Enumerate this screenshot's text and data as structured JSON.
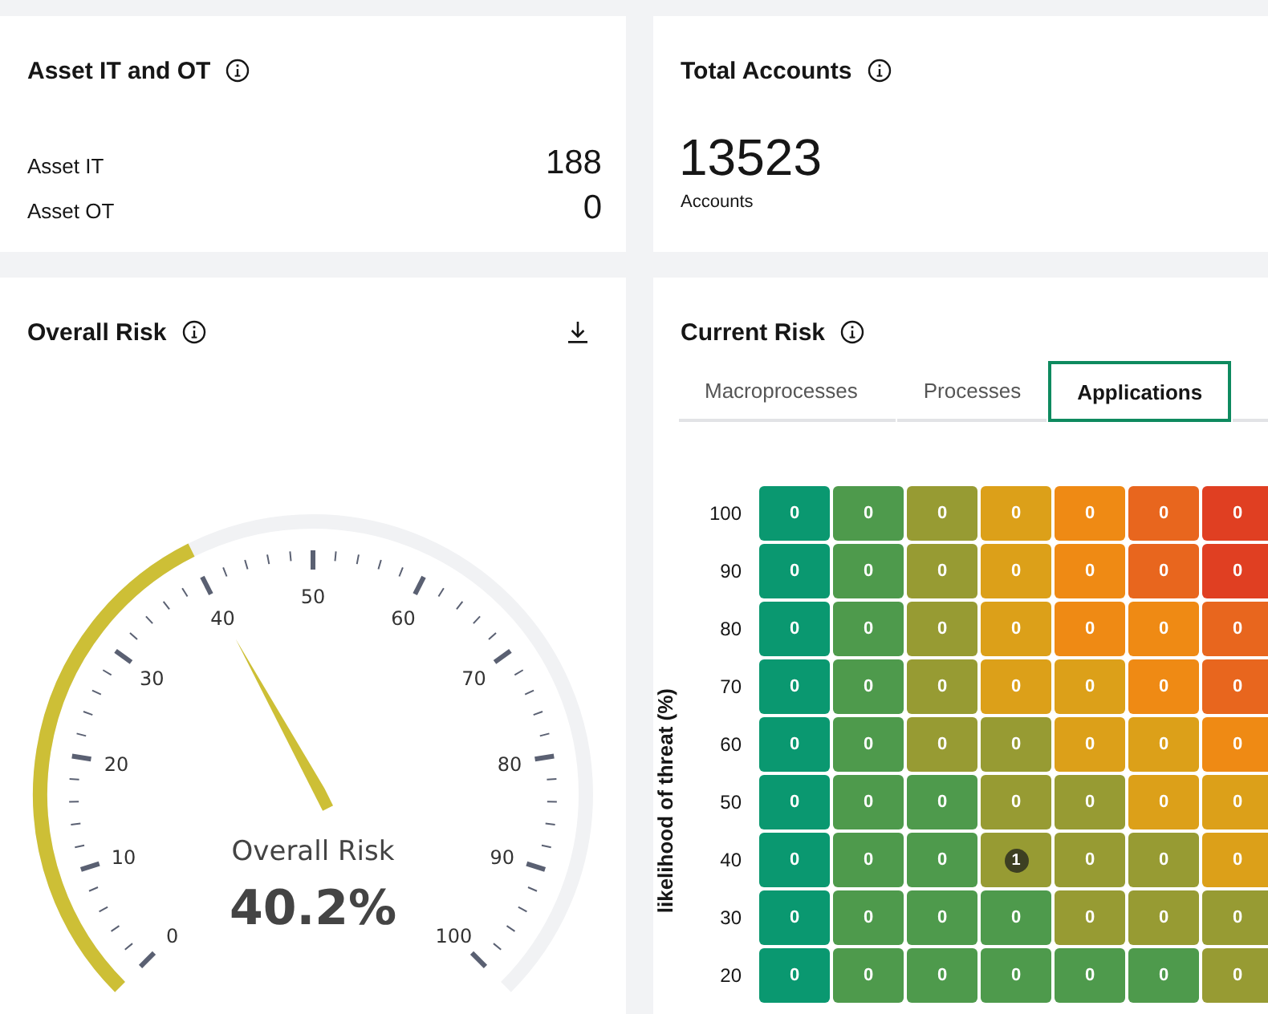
{
  "asset_card": {
    "title": "Asset IT and OT",
    "rows": [
      {
        "label": "Asset IT",
        "value": "188"
      },
      {
        "label": "Asset OT",
        "value": "0"
      }
    ]
  },
  "accounts_card": {
    "title": "Total Accounts",
    "value": "13523",
    "caption": "Accounts"
  },
  "overall_risk": {
    "title": "Overall Risk",
    "gauge": {
      "label": "Overall Risk",
      "value_text": "40.2%",
      "level": 0.402,
      "scale_labels": [
        "0",
        "10",
        "20",
        "30",
        "40",
        "50",
        "60",
        "70",
        "80",
        "90",
        "100"
      ]
    }
  },
  "current_risk": {
    "title": "Current Risk",
    "tabs": [
      {
        "label": "Macroprocesses",
        "selected": false
      },
      {
        "label": "Processes",
        "selected": false
      },
      {
        "label": "Applications",
        "selected": true
      }
    ],
    "y_axis_label": "likelihood of threat (%)",
    "rows": [
      {
        "label": "100",
        "cells": [
          {
            "kind": "count",
            "value": "0",
            "color": "#0a9870"
          },
          {
            "kind": "count",
            "value": "0",
            "color": "#4e9a4c"
          },
          {
            "kind": "count",
            "value": "0",
            "color": "#979b33"
          },
          {
            "kind": "count",
            "value": "0",
            "color": "#dca019"
          },
          {
            "kind": "count",
            "value": "0",
            "color": "#ef8a14"
          },
          {
            "kind": "count",
            "value": "0",
            "color": "#e8661e"
          },
          {
            "kind": "count",
            "value": "0",
            "color": "#e03f22"
          }
        ]
      },
      {
        "label": "90",
        "cells": [
          {
            "kind": "count",
            "value": "0",
            "color": "#0a9870"
          },
          {
            "kind": "count",
            "value": "0",
            "color": "#4e9a4c"
          },
          {
            "kind": "count",
            "value": "0",
            "color": "#979b33"
          },
          {
            "kind": "count",
            "value": "0",
            "color": "#dca019"
          },
          {
            "kind": "count",
            "value": "0",
            "color": "#ef8a14"
          },
          {
            "kind": "count",
            "value": "0",
            "color": "#e8661e"
          },
          {
            "kind": "count",
            "value": "0",
            "color": "#e03f22"
          }
        ]
      },
      {
        "label": "80",
        "cells": [
          {
            "kind": "count",
            "value": "0",
            "color": "#0a9870"
          },
          {
            "kind": "count",
            "value": "0",
            "color": "#4e9a4c"
          },
          {
            "kind": "count",
            "value": "0",
            "color": "#979b33"
          },
          {
            "kind": "count",
            "value": "0",
            "color": "#dca019"
          },
          {
            "kind": "count",
            "value": "0",
            "color": "#ef8a14"
          },
          {
            "kind": "count",
            "value": "0",
            "color": "#ef8a14"
          },
          {
            "kind": "count",
            "value": "0",
            "color": "#e8661e"
          }
        ]
      },
      {
        "label": "70",
        "cells": [
          {
            "kind": "count",
            "value": "0",
            "color": "#0a9870"
          },
          {
            "kind": "count",
            "value": "0",
            "color": "#4e9a4c"
          },
          {
            "kind": "count",
            "value": "0",
            "color": "#979b33"
          },
          {
            "kind": "count",
            "value": "0",
            "color": "#dca019"
          },
          {
            "kind": "count",
            "value": "0",
            "color": "#dca019"
          },
          {
            "kind": "count",
            "value": "0",
            "color": "#ef8a14"
          },
          {
            "kind": "count",
            "value": "0",
            "color": "#e8661e"
          }
        ]
      },
      {
        "label": "60",
        "cells": [
          {
            "kind": "count",
            "value": "0",
            "color": "#0a9870"
          },
          {
            "kind": "count",
            "value": "0",
            "color": "#4e9a4c"
          },
          {
            "kind": "count",
            "value": "0",
            "color": "#979b33"
          },
          {
            "kind": "count",
            "value": "0",
            "color": "#979b33"
          },
          {
            "kind": "count",
            "value": "0",
            "color": "#dca019"
          },
          {
            "kind": "count",
            "value": "0",
            "color": "#dca019"
          },
          {
            "kind": "count",
            "value": "0",
            "color": "#ef8a14"
          }
        ]
      },
      {
        "label": "50",
        "cells": [
          {
            "kind": "count",
            "value": "0",
            "color": "#0a9870"
          },
          {
            "kind": "count",
            "value": "0",
            "color": "#4e9a4c"
          },
          {
            "kind": "count",
            "value": "0",
            "color": "#4e9a4c"
          },
          {
            "kind": "count",
            "value": "0",
            "color": "#979b33"
          },
          {
            "kind": "count",
            "value": "0",
            "color": "#979b33"
          },
          {
            "kind": "count",
            "value": "0",
            "color": "#dca019"
          },
          {
            "kind": "count",
            "value": "0",
            "color": "#dca019"
          }
        ]
      },
      {
        "label": "40",
        "cells": [
          {
            "kind": "count",
            "value": "0",
            "color": "#0a9870"
          },
          {
            "kind": "count",
            "value": "0",
            "color": "#4e9a4c"
          },
          {
            "kind": "count",
            "value": "0",
            "color": "#4e9a4c"
          },
          {
            "kind": "badge",
            "value": "1",
            "color": "#979b33"
          },
          {
            "kind": "count",
            "value": "0",
            "color": "#979b33"
          },
          {
            "kind": "count",
            "value": "0",
            "color": "#979b33"
          },
          {
            "kind": "count",
            "value": "0",
            "color": "#dca019"
          }
        ]
      },
      {
        "label": "30",
        "cells": [
          {
            "kind": "count",
            "value": "0",
            "color": "#0a9870"
          },
          {
            "kind": "count",
            "value": "0",
            "color": "#4e9a4c"
          },
          {
            "kind": "count",
            "value": "0",
            "color": "#4e9a4c"
          },
          {
            "kind": "count",
            "value": "0",
            "color": "#4e9a4c"
          },
          {
            "kind": "count",
            "value": "0",
            "color": "#979b33"
          },
          {
            "kind": "count",
            "value": "0",
            "color": "#979b33"
          },
          {
            "kind": "count",
            "value": "0",
            "color": "#979b33"
          }
        ]
      },
      {
        "label": "20",
        "cells": [
          {
            "kind": "count",
            "value": "0",
            "color": "#0a9870"
          },
          {
            "kind": "count",
            "value": "0",
            "color": "#4e9a4c"
          },
          {
            "kind": "count",
            "value": "0",
            "color": "#4e9a4c"
          },
          {
            "kind": "count",
            "value": "0",
            "color": "#4e9a4c"
          },
          {
            "kind": "count",
            "value": "0",
            "color": "#4e9a4c"
          },
          {
            "kind": "count",
            "value": "0",
            "color": "#4e9a4c"
          },
          {
            "kind": "count",
            "value": "0",
            "color": "#979b33"
          }
        ]
      }
    ]
  }
}
